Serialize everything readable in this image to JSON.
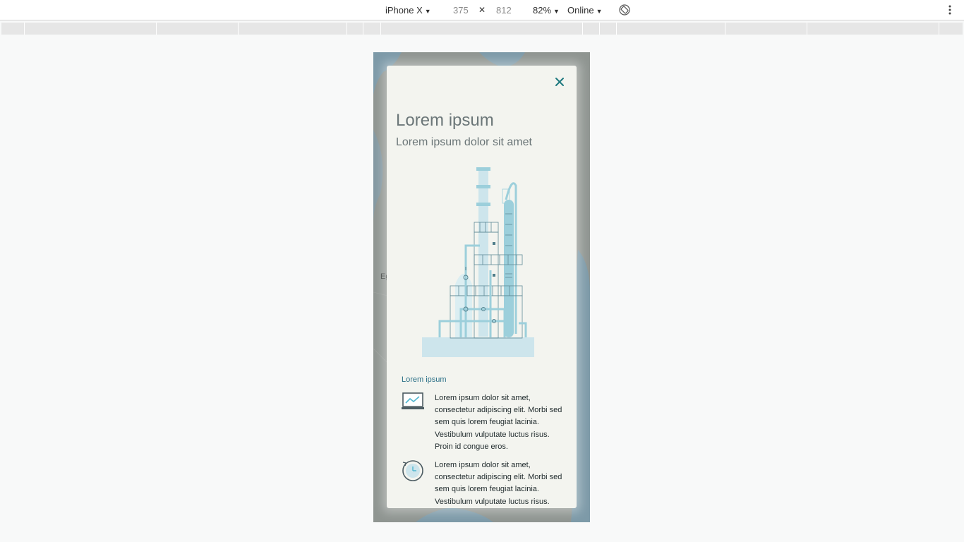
{
  "toolbar": {
    "device": "iPhone X",
    "width": "375",
    "times": "✕",
    "height": "812",
    "zoom": "82%",
    "network": "Online"
  },
  "map": {
    "label_fragment": "Eg"
  },
  "modal": {
    "title": "Lorem ipsum",
    "subtitle": "Lorem ipsum dolor sit amet",
    "section_heading": "Lorem ipsum",
    "features": [
      {
        "icon": "laptop-chart-icon",
        "text": "Lorem ipsum dolor sit amet, consectetur adipiscing elit. Morbi sed sem quis lorem feugiat lacinia. Vestibulum vulputate luctus risus. Proin id congue eros."
      },
      {
        "icon": "clock-refresh-icon",
        "text": "Lorem ipsum dolor sit amet, consectetur adipiscing elit. Morbi sed sem quis lorem feugiat lacinia. Vestibulum vulputate luctus risus."
      }
    ]
  },
  "colors": {
    "accent": "#1f7a7f",
    "heading": "#6b7678",
    "link": "#2a6f86",
    "illustration": "#a8d4de"
  }
}
